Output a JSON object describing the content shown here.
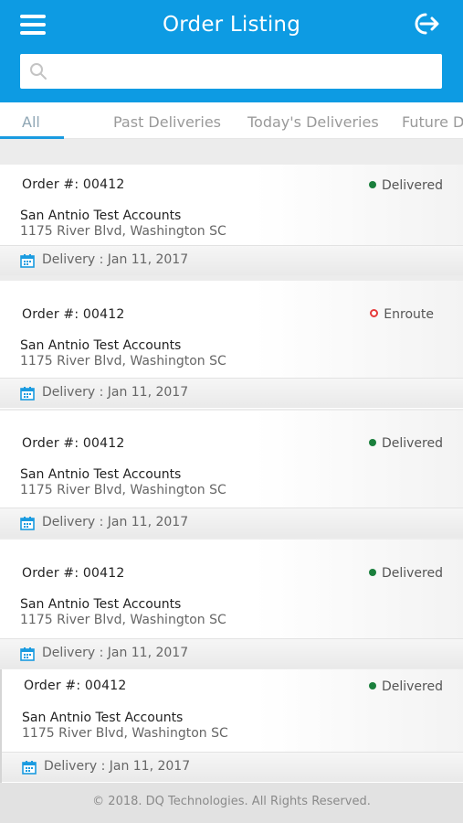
{
  "header": {
    "title": "Order Listing",
    "menu_icon": "hamburger-menu-icon",
    "logout_icon": "logout-icon",
    "color": "#0d9be3"
  },
  "search": {
    "placeholder": "",
    "value": ""
  },
  "tabs": [
    {
      "label": "All",
      "active": true
    },
    {
      "label": "Past Deliveries",
      "active": false
    },
    {
      "label": "Today's Deliveries",
      "active": false
    },
    {
      "label": "Future D",
      "active": false
    }
  ],
  "orders": [
    {
      "order": "Order #: 00412",
      "status": "Delivered",
      "account": "San Antnio Test Accounts",
      "address": "1175 River Blvd, Washington SC",
      "delivery": "Delivery : Jan 11, 2017"
    },
    {
      "order": "Order #: 00412",
      "status": "Enroute",
      "account": "San Antnio Test Accounts",
      "address": "1175 River Blvd, Washington SC",
      "delivery": "Delivery : Jan 11, 2017"
    },
    {
      "order": "Order #: 00412",
      "status": "Delivered",
      "account": "San Antnio Test Accounts",
      "address": "1175 River Blvd, Washington SC",
      "delivery": "Delivery : Jan 11, 2017"
    },
    {
      "order": "Order #: 00412",
      "status": "Delivered",
      "account": "San Antnio Test Accounts",
      "address": "1175 River Blvd, Washington SC",
      "delivery": "Delivery : Jan 11, 2017"
    },
    {
      "order": "Order #: 00412",
      "status": "Delivered",
      "account": "San Antnio Test Accounts",
      "address": "1175 River Blvd, Washington SC",
      "delivery": "Delivery : Jan 11, 2017"
    }
  ],
  "status_colors": {
    "Delivered": "#1a7f3c",
    "Enroute": "#e53a3a"
  },
  "footer": {
    "copyright": "© 2018. DQ Technologies. All Rights Reserved."
  }
}
